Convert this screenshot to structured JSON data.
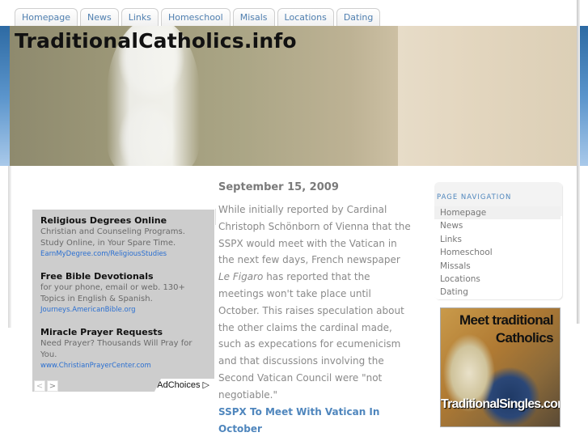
{
  "tabs": [
    "Homepage",
    "News",
    "Links",
    "Homeschool",
    "Misals",
    "Locations",
    "Dating"
  ],
  "site": {
    "title": "TraditionalCatholics.info"
  },
  "ads": {
    "items": [
      {
        "title": "Religious Degrees Online",
        "description": "Christian and Counseling Programs. Study Online, in Your Spare Time.",
        "url": "EarnMyDegree.com/ReligiousStudies"
      },
      {
        "title": "Free Bible Devotionals",
        "description": "for your phone, email or web. 130+ Topics in English & Spanish.",
        "url": "Journeys.AmericanBible.org"
      },
      {
        "title": "Miracle Prayer Requests",
        "description": "Need Prayer? Thousands Will Pray for You.",
        "url": "www.ChristianPrayerCenter.com"
      }
    ],
    "prev_label": "<",
    "next_label": ">",
    "adchoices_label": "AdChoices ▷"
  },
  "post": {
    "date": "September 15, 2009",
    "body_before_italic": "While initially reported by Cardinal Christoph Schönborn of Vienna that the SSPX would meet with the Vatican in the next few days, French newspaper ",
    "italic": "Le Figaro",
    "body_after_italic": " has reported that the meetings won't take place until October. This raises speculation about the other claims the cardinal made, such as expecations for ecumenicism and that discussions involving the Second Vatican Council were \"not negotiable.\"",
    "link_label": "SSPX To Meet With Vatican In October"
  },
  "sidebar": {
    "heading": "PAGE NAVIGATION",
    "items": [
      "Homepage",
      "News",
      "Links",
      "Homeschool",
      "Missals",
      "Locations",
      "Dating"
    ],
    "active_index": 0
  },
  "image_ad": {
    "headline": "Meet traditional Catholics",
    "headline_line1": "Meet traditional",
    "headline_line2": "Catholics",
    "site": "TraditionalSingles.com"
  }
}
